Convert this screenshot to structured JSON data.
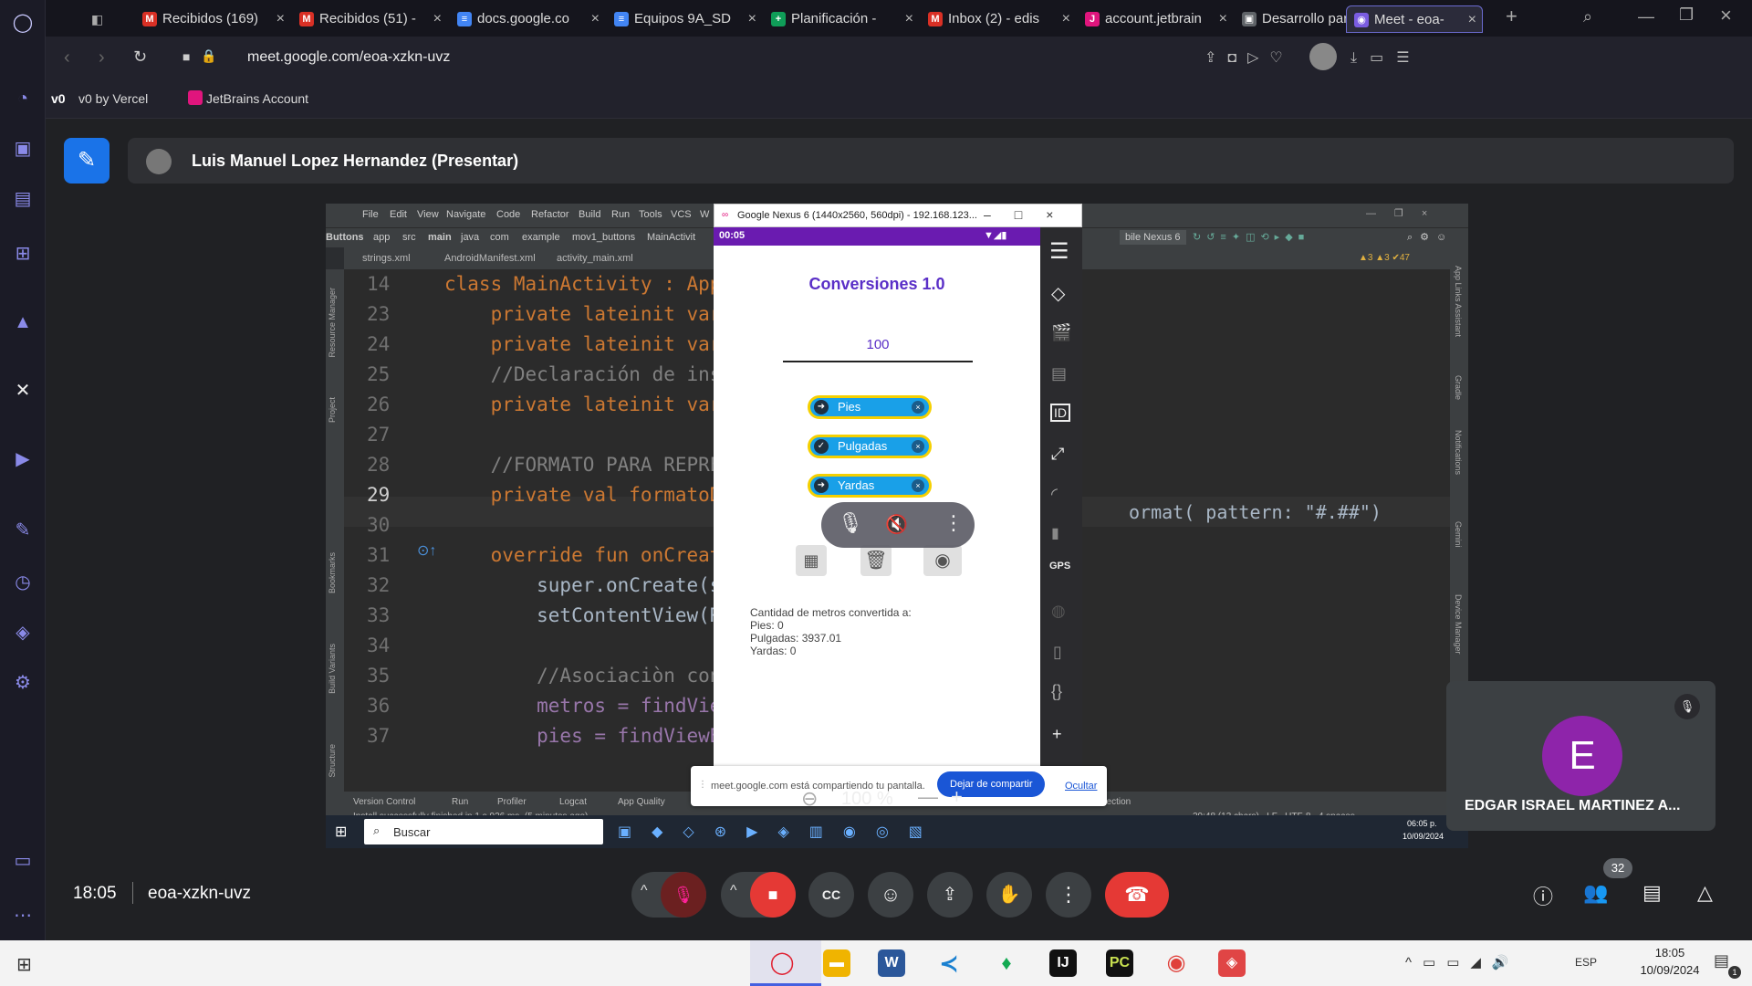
{
  "browser": {
    "tabs": [
      {
        "label": "Recibidos (169)",
        "icon": "gmail-icon"
      },
      {
        "label": "Recibidos (51) -",
        "icon": "gmail-icon"
      },
      {
        "label": "docs.google.co",
        "icon": "docs-icon"
      },
      {
        "label": "Equipos 9A_SD",
        "icon": "docs-icon"
      },
      {
        "label": "Planificación -",
        "icon": "sheets-icon"
      },
      {
        "label": "Inbox (2) - edis",
        "icon": "gmail-icon"
      },
      {
        "label": "account.jetbrain",
        "icon": "jetbrains-icon"
      },
      {
        "label": "Desarrollo para",
        "icon": "classroom-icon"
      },
      {
        "label": "Meet - eoa-",
        "icon": "meet-icon"
      }
    ],
    "url": "meet.google.com/eoa-xzkn-uvz",
    "bookmarks": [
      "v0 by Vercel",
      "JetBrains Account"
    ]
  },
  "meet": {
    "presenter": "Luis Manuel Lopez Hernandez (Presentar)",
    "time": "18:05",
    "code": "eoa-xzkn-uvz",
    "participant_name": "EDGAR ISRAEL MARTINEZ A...",
    "participant_initial": "E",
    "participants_count": "32",
    "colors": {
      "end_call": "#e53935",
      "avatar": "#8e24aa",
      "accent": "#1a73e8"
    }
  },
  "ide": {
    "menu": [
      "File",
      "Edit",
      "View",
      "Navigate",
      "Code",
      "Refactor",
      "Build",
      "Run",
      "Tools",
      "VCS",
      "W"
    ],
    "breadcrumbs": [
      "Buttons",
      "app",
      "src",
      "main",
      "java",
      "com",
      "example",
      "mov1_buttons",
      "MainActivit"
    ],
    "file_tabs": [
      "strings.xml",
      "AndroidManifest.xml",
      "activity_main.xml"
    ],
    "device": "bile Nexus 6",
    "inspections": "▲3 ▲3 ✔47",
    "code_lines": [
      {
        "n": "14",
        "text": "class MainActivity : AppC"
      },
      {
        "n": "23",
        "text": "    private lateinit var"
      },
      {
        "n": "24",
        "text": "    private lateinit var"
      },
      {
        "n": "25",
        "text": "    //Declaración de inst"
      },
      {
        "n": "26",
        "text": "    private lateinit var"
      },
      {
        "n": "27",
        "text": ""
      },
      {
        "n": "28",
        "text": "    //FORMATO PARA REPRES"
      },
      {
        "n": "29",
        "text": "    private val formatoDe"
      },
      {
        "n": "30",
        "text": ""
      },
      {
        "n": "31",
        "text": "    override fun onCreate"
      },
      {
        "n": "32",
        "text": "        super.onCreate(sa"
      },
      {
        "n": "33",
        "text": "        setContentView(R."
      },
      {
        "n": "34",
        "text": ""
      },
      {
        "n": "35",
        "text": "        //Asociaciòn con"
      },
      {
        "n": "36",
        "text": "        metros = findView"
      },
      {
        "n": "37",
        "text": "        pies = findViewBy"
      }
    ],
    "code_right": "ormat( pattern: \"#.##\")",
    "bottom_tools": [
      "Version Control",
      "Run",
      "Profiler",
      "Logcat",
      "App Quality"
    ],
    "status_msg": "Install successfully finished in 1 s 926 ms. (5 minutes ago)",
    "status_right": "29:48 (13 chars)   LF   UTF-8   4 spaces",
    "inspection_tab": "pection",
    "side_tools": [
      "Resource Manager",
      "Project",
      "Bookmarks",
      "Build Variants",
      "Structure"
    ],
    "right_tools": [
      "App Links Assistant",
      "Gradle",
      "Notifications",
      "Gemini",
      "Device Manager"
    ]
  },
  "emulator": {
    "title": "Google Nexus 6 (1440x2560, 560dpi) - 192.168.123...",
    "clock": "00:05",
    "app_title": "Conversiones 1.0",
    "input_value": "100",
    "chips": [
      {
        "label": "Pies",
        "checked": false
      },
      {
        "label": "Pulgadas",
        "checked": true
      },
      {
        "label": "Yardas",
        "checked": false
      }
    ],
    "result_lines": [
      "Cantidad de metros convertida a:",
      "Pies: 0",
      "Pulgadas: 3937.01",
      "Yardas: 0"
    ]
  },
  "share_bar": {
    "message": "meet.google.com está compartiendo tu pantalla.",
    "stop_label": "Dejar de compartir",
    "hide_label": "Ocultar",
    "zoom": "100 %"
  },
  "inner_taskbar": {
    "search": "Buscar",
    "time": "06:05 p.",
    "date": "10/09/2024"
  },
  "taskbar": {
    "time": "18:05",
    "date": "10/09/2024",
    "lang": "ESP",
    "notif": "1"
  }
}
